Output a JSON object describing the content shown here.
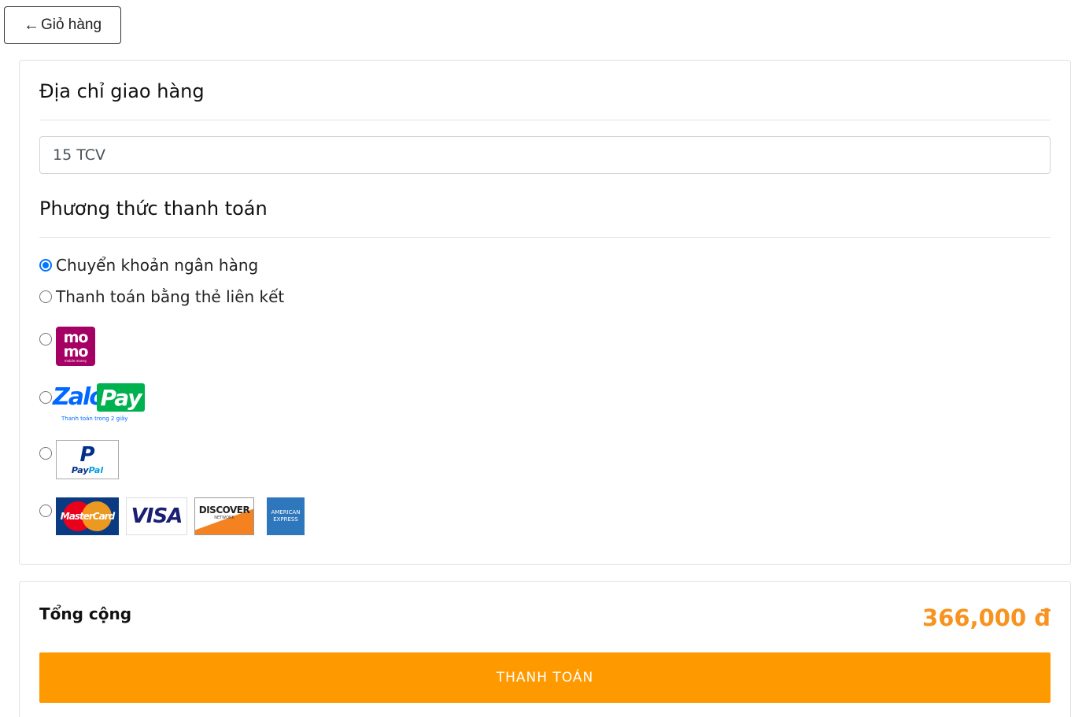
{
  "back_button": {
    "arrow": "←",
    "label": "Giỏ hàng"
  },
  "shipping": {
    "title": "Địa chỉ giao hàng",
    "address_value": "15 TCV"
  },
  "payment": {
    "title": "Phương thức thanh toán",
    "options": [
      {
        "label": "Chuyển khoản ngân hàng",
        "checked": true
      },
      {
        "label": "Thanh toán bằng thẻ liên kết",
        "checked": false
      },
      {
        "logo": "momo-logo",
        "checked": false
      },
      {
        "logo": "zalopay-logo",
        "checked": false
      },
      {
        "logo": "paypal-logo",
        "checked": false
      },
      {
        "logo": "credit-cards-logos",
        "checked": false
      }
    ],
    "logos": {
      "momo": {
        "line1": "mo",
        "line2": "mo",
        "sub": "mobile money"
      },
      "zalopay": {
        "zalo": "Zalo",
        "pay": "Pay",
        "tagline": "Thanh toán trong 2 giây"
      },
      "paypal": {
        "mark": "P",
        "word_a": "Pay",
        "word_b": "Pal"
      },
      "mastercard": "MasterCard",
      "visa": "VISA",
      "discover": {
        "word": "DISCOVER",
        "sub": "NETWORK"
      },
      "amex": {
        "line1": "AMERICAN",
        "line2": "EXPRESS"
      }
    }
  },
  "summary": {
    "total_label": "Tổng cộng",
    "total_value": "366,000 đ",
    "pay_button": "THANH TOÁN"
  },
  "colors": {
    "accent": "#ff9900",
    "total": "#f7931e",
    "radio_checked": "#0075ff",
    "momo": "#a50064",
    "zalo_blue": "#0068ff",
    "zalo_green": "#00b14f"
  }
}
